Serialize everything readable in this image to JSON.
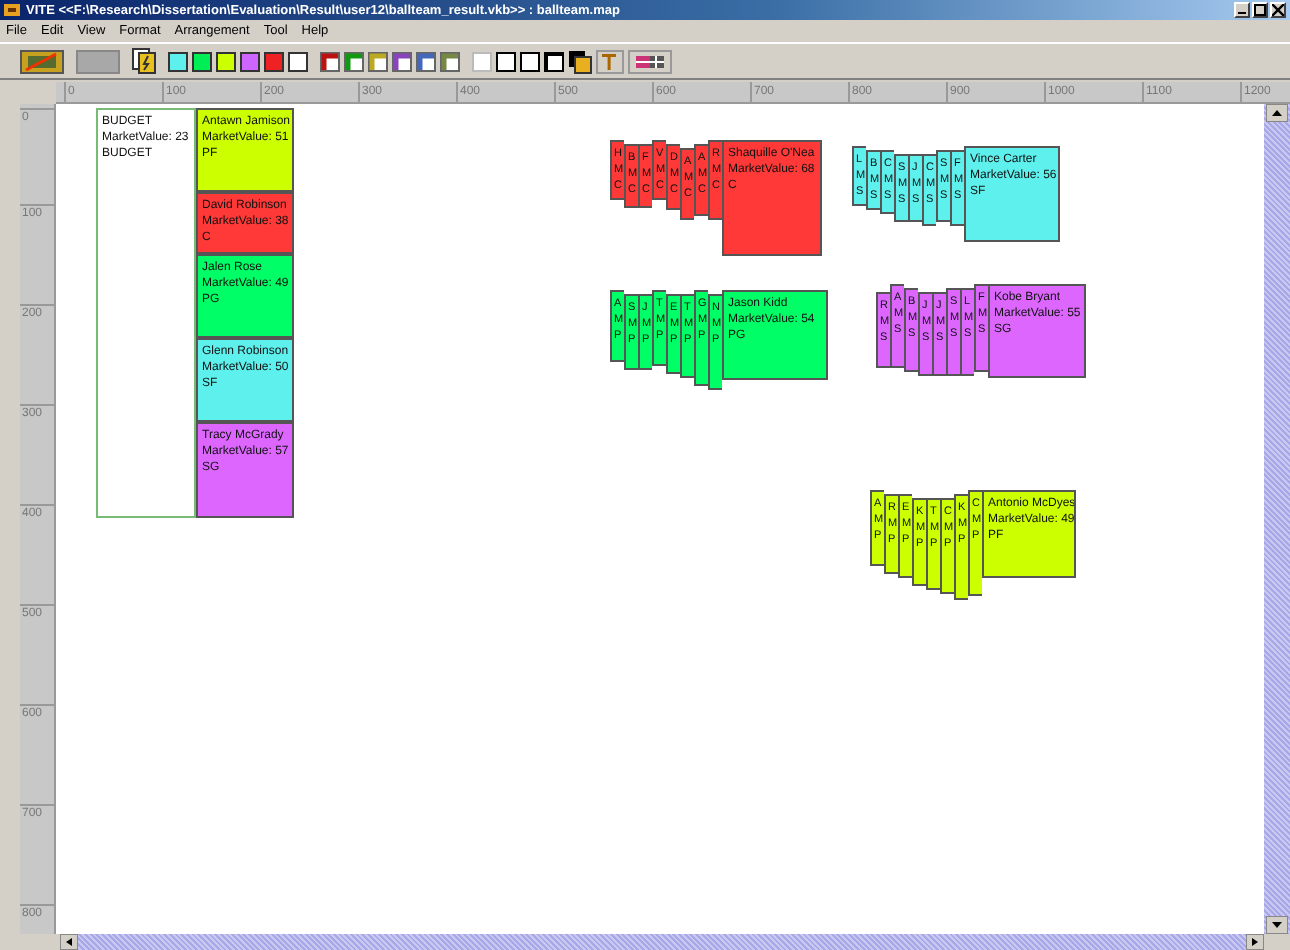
{
  "window": {
    "title": "VITE  <<F:\\Research\\Dissertation\\Evaluation\\Result\\user12\\ballteam_result.vkb>> : ballteam.map"
  },
  "menu": [
    "File",
    "Edit",
    "View",
    "Format",
    "Arrangement",
    "Tool",
    "Help"
  ],
  "toolbar": {
    "fill_colors": [
      {
        "color": "#5ef0ec"
      },
      {
        "color": "#00ee55"
      },
      {
        "color": "#ccff00"
      },
      {
        "color": "#cc66ff"
      },
      {
        "color": "#ee2222"
      },
      {
        "color": "#ffffff"
      }
    ],
    "border_colors": [
      {
        "color": "#bb1111"
      },
      {
        "color": "#119911"
      },
      {
        "color": "#bbaa22"
      },
      {
        "color": "#8844bb"
      },
      {
        "color": "#4466bb"
      },
      {
        "color": "#778844"
      }
    ]
  },
  "ruler": {
    "h_ticks": [
      "0",
      "100",
      "200",
      "300",
      "400",
      "500",
      "600",
      "700",
      "800",
      "900",
      "1000",
      "1100",
      "1200"
    ],
    "v_ticks": [
      "0",
      "100",
      "200",
      "300",
      "400",
      "500",
      "600",
      "700",
      "800"
    ]
  },
  "canvas": {
    "budget": {
      "lines": [
        "BUDGET",
        "MarketValue: 23",
        "BUDGET"
      ]
    },
    "roster": [
      {
        "lines": [
          "Antawn Jamison",
          "MarketValue: 51",
          "PF"
        ],
        "color": "#ccff00"
      },
      {
        "lines": [
          "David Robinson",
          "MarketValue: 38",
          "C"
        ],
        "color": "#ff3838"
      },
      {
        "lines": [
          "Jalen Rose",
          "MarketValue: 49",
          "PG"
        ],
        "color": "#00ff66"
      },
      {
        "lines": [
          "Glenn Robinson",
          "MarketValue: 50",
          "SF"
        ],
        "color": "#5ef0ec"
      },
      {
        "lines": [
          "Tracy McGrady",
          "MarketValue: 57",
          "SG"
        ],
        "color": "#dd66ff"
      }
    ],
    "stacks": [
      {
        "color": "#ff3838",
        "hidden": [
          [
            "H",
            "M",
            "C"
          ],
          [
            "B",
            "M",
            "C"
          ],
          [
            "F",
            "M",
            "C"
          ],
          [
            "V",
            "M",
            "C"
          ],
          [
            "D",
            "M",
            "C"
          ],
          [
            "A",
            "M",
            "C"
          ],
          [
            "A",
            "M",
            "C"
          ],
          [
            "R",
            "M",
            "C"
          ]
        ],
        "top": [
          "Shaquille O'Nea",
          "MarketValue: 68",
          "C"
        ]
      },
      {
        "color": "#00ff66",
        "hidden": [
          [
            "A",
            "M",
            "P"
          ],
          [
            "S",
            "M",
            "P"
          ],
          [
            "J",
            "M",
            "P"
          ],
          [
            "T",
            "M",
            "P"
          ],
          [
            "E",
            "M",
            "P"
          ],
          [
            "T",
            "M",
            "P"
          ],
          [
            "G",
            "M",
            "P"
          ],
          [
            "N",
            "M",
            "P"
          ]
        ],
        "top": [
          "Jason Kidd",
          "MarketValue: 54",
          "PG"
        ]
      },
      {
        "color": "#5ef0ec",
        "hidden": [
          [
            "L",
            "M",
            "S"
          ],
          [
            "B",
            "M",
            "S"
          ],
          [
            "C",
            "M",
            "S"
          ],
          [
            "S",
            "M",
            "S"
          ],
          [
            "J",
            "M",
            "S"
          ],
          [
            "C",
            "M",
            "S"
          ],
          [
            "S",
            "M",
            "S"
          ],
          [
            "F",
            "M",
            "S"
          ]
        ],
        "top": [
          "Vince Carter",
          "MarketValue: 56",
          "SF"
        ]
      },
      {
        "color": "#dd66ff",
        "hidden": [
          [
            "R",
            "M",
            "S"
          ],
          [
            "A",
            "M",
            "S"
          ],
          [
            "B",
            "M",
            "S"
          ],
          [
            "J",
            "M",
            "S"
          ],
          [
            "J",
            "M",
            "S"
          ],
          [
            "S",
            "M",
            "S"
          ],
          [
            "L",
            "M",
            "S"
          ],
          [
            "F",
            "M",
            "S"
          ]
        ],
        "top": [
          "Kobe Bryant",
          "MarketValue: 55",
          "SG"
        ]
      },
      {
        "color": "#ccff00",
        "hidden": [
          [
            "A",
            "M",
            "P"
          ],
          [
            "R",
            "M",
            "P"
          ],
          [
            "E",
            "M",
            "P"
          ],
          [
            "K",
            "M",
            "P"
          ],
          [
            "T",
            "M",
            "P"
          ],
          [
            "C",
            "M",
            "P"
          ],
          [
            "K",
            "M",
            "P"
          ],
          [
            "C",
            "M",
            "P"
          ]
        ],
        "top": [
          "Antonio McDyes",
          "MarketValue: 49",
          "PF"
        ]
      }
    ]
  }
}
